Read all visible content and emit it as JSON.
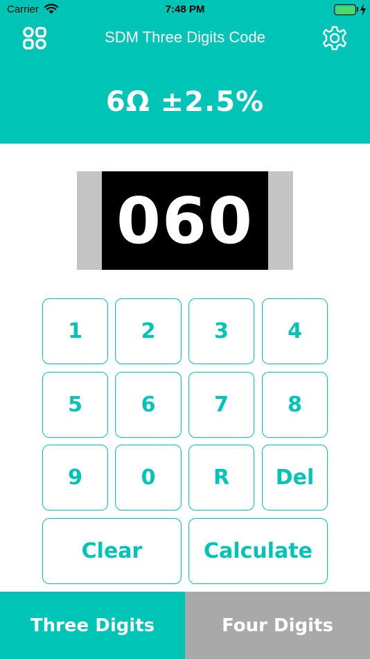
{
  "status_bar": {
    "carrier": "Carrier",
    "time": "7:48 PM",
    "battery_color": "#4cd964"
  },
  "header": {
    "title": "SDM Three Digits Code",
    "result": "6Ω ±2.5%",
    "left_icon": "apps-grid-icon",
    "right_icon": "settings-gear-icon",
    "color": "#00c4b5"
  },
  "display": {
    "code": "060"
  },
  "keypad": {
    "k1": "1",
    "k2": "2",
    "k3": "3",
    "k4": "4",
    "k5": "5",
    "k6": "6",
    "k7": "7",
    "k8": "8",
    "k9": "9",
    "k0": "0",
    "kR": "R",
    "del": "Del",
    "clear": "Clear",
    "calculate": "Calculate"
  },
  "tabs": {
    "three": "Three Digits",
    "four": "Four Digits",
    "active": "Three Digits",
    "inactive_color": "#a9a9a9"
  }
}
